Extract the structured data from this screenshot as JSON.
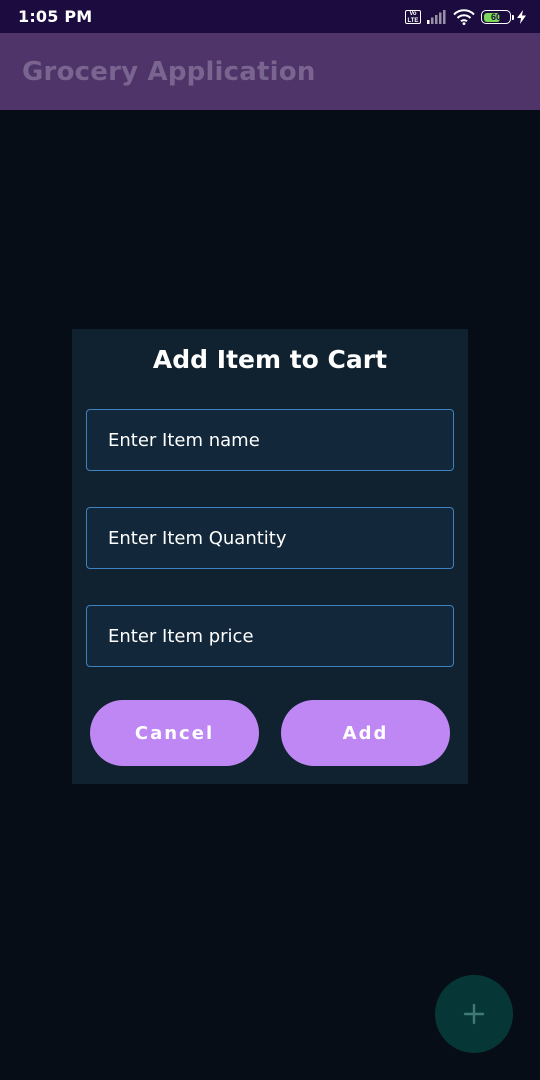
{
  "status_bar": {
    "time": "1:05 PM",
    "volte_label": "Vo LTE",
    "battery_level": "60",
    "icons": [
      "volte-icon",
      "signal-icon",
      "wifi-icon",
      "battery-icon",
      "charging-icon"
    ]
  },
  "app_bar": {
    "title": "Grocery Application"
  },
  "dialog": {
    "title": "Add Item to Cart",
    "fields": {
      "name_placeholder": "Enter Item name",
      "quantity_placeholder": "Enter Item Quantity",
      "price_placeholder": "Enter Item price"
    },
    "cancel_label": "Cancel",
    "add_label": "Add"
  },
  "fab": {
    "icon": "plus-icon"
  },
  "colors": {
    "status_bar": "#1b0b3e",
    "app_bar": "#4e3468",
    "background": "#060d16",
    "dialog": "#10222f",
    "field_border": "#3f82c0",
    "button": "#bf87f3",
    "fab": "#063736"
  }
}
